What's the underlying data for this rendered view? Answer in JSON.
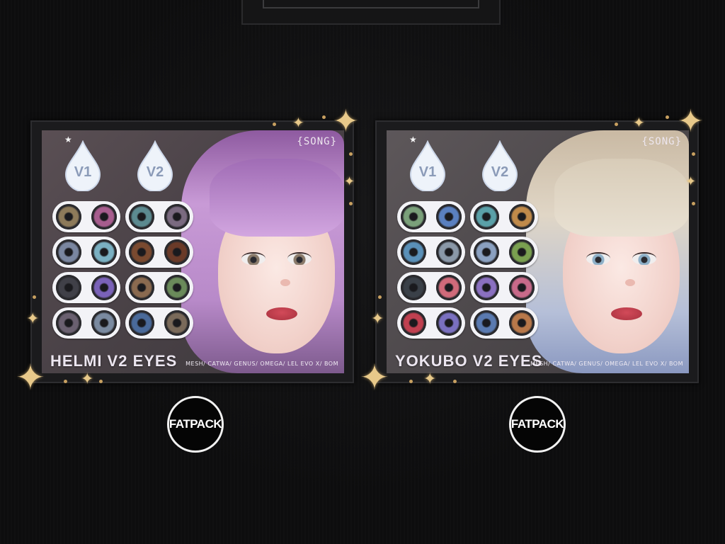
{
  "products": [
    {
      "title": "HELMI V2 EYES",
      "brand_tag": "{SONG}",
      "compatibility": "MESH/ CATWA/ GENUS/ OMEGA/ LEL EVO X/ BOM",
      "version_labels": [
        "V1",
        "V2"
      ],
      "fatpack_label": "FATPACK",
      "lens_colors": [
        [
          "#8d7a5a",
          "#a75d8e",
          "#5c8a90",
          "#7a6a80"
        ],
        [
          "#7a86a0",
          "#7ab0c2",
          "#7a4a30",
          "#6a3a28"
        ],
        [
          "#404048",
          "#7a62b8",
          "#8a6a50",
          "#6a8a5a"
        ],
        [
          "#6a6070",
          "#7a8aa0",
          "#4a6a9a",
          "#7a6a5a"
        ]
      ]
    },
    {
      "title": "YOKUBO V2 EYES",
      "brand_tag": "{SONG}",
      "compatibility": "MESH/ CATWA/ GENUS/ OMEGA/ LEL EVO X/ BOM",
      "version_labels": [
        "V1",
        "V2"
      ],
      "fatpack_label": "FATPACK",
      "lens_colors": [
        [
          "#7aa07a",
          "#5a80c0",
          "#5aa0a8",
          "#c08a4a"
        ],
        [
          "#5a90b8",
          "#8a98a8",
          "#8aa0c0",
          "#7aa050"
        ],
        [
          "#3a4048",
          "#d06a7a",
          "#8a70c0",
          "#c86a8a"
        ],
        [
          "#c04050",
          "#7a70c0",
          "#5a7ab0",
          "#b8784a"
        ]
      ]
    }
  ]
}
